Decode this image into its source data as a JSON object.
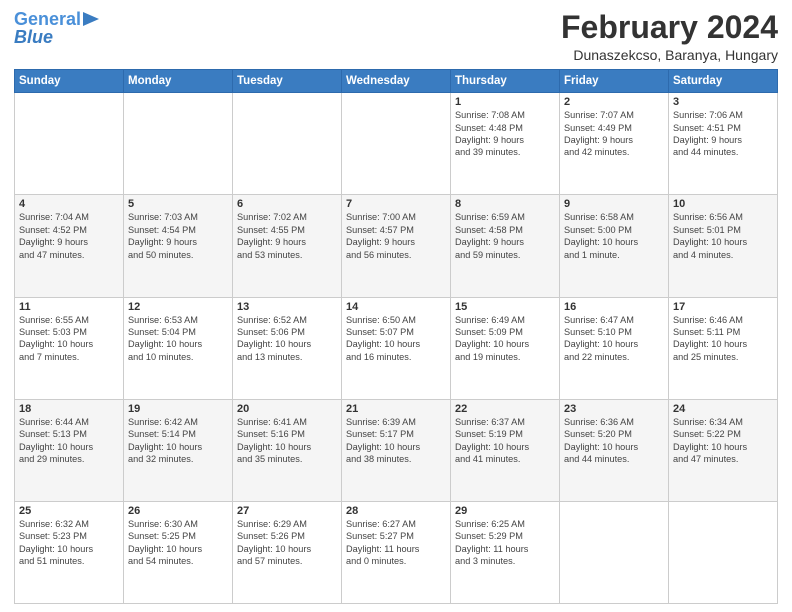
{
  "header": {
    "logo_line1": "General",
    "logo_line2": "Blue",
    "month": "February 2024",
    "location": "Dunaszekcso, Baranya, Hungary"
  },
  "days_of_week": [
    "Sunday",
    "Monday",
    "Tuesday",
    "Wednesday",
    "Thursday",
    "Friday",
    "Saturday"
  ],
  "weeks": [
    [
      {
        "day": "",
        "info": ""
      },
      {
        "day": "",
        "info": ""
      },
      {
        "day": "",
        "info": ""
      },
      {
        "day": "",
        "info": ""
      },
      {
        "day": "1",
        "info": "Sunrise: 7:08 AM\nSunset: 4:48 PM\nDaylight: 9 hours\nand 39 minutes."
      },
      {
        "day": "2",
        "info": "Sunrise: 7:07 AM\nSunset: 4:49 PM\nDaylight: 9 hours\nand 42 minutes."
      },
      {
        "day": "3",
        "info": "Sunrise: 7:06 AM\nSunset: 4:51 PM\nDaylight: 9 hours\nand 44 minutes."
      }
    ],
    [
      {
        "day": "4",
        "info": "Sunrise: 7:04 AM\nSunset: 4:52 PM\nDaylight: 9 hours\nand 47 minutes."
      },
      {
        "day": "5",
        "info": "Sunrise: 7:03 AM\nSunset: 4:54 PM\nDaylight: 9 hours\nand 50 minutes."
      },
      {
        "day": "6",
        "info": "Sunrise: 7:02 AM\nSunset: 4:55 PM\nDaylight: 9 hours\nand 53 minutes."
      },
      {
        "day": "7",
        "info": "Sunrise: 7:00 AM\nSunset: 4:57 PM\nDaylight: 9 hours\nand 56 minutes."
      },
      {
        "day": "8",
        "info": "Sunrise: 6:59 AM\nSunset: 4:58 PM\nDaylight: 9 hours\nand 59 minutes."
      },
      {
        "day": "9",
        "info": "Sunrise: 6:58 AM\nSunset: 5:00 PM\nDaylight: 10 hours\nand 1 minute."
      },
      {
        "day": "10",
        "info": "Sunrise: 6:56 AM\nSunset: 5:01 PM\nDaylight: 10 hours\nand 4 minutes."
      }
    ],
    [
      {
        "day": "11",
        "info": "Sunrise: 6:55 AM\nSunset: 5:03 PM\nDaylight: 10 hours\nand 7 minutes."
      },
      {
        "day": "12",
        "info": "Sunrise: 6:53 AM\nSunset: 5:04 PM\nDaylight: 10 hours\nand 10 minutes."
      },
      {
        "day": "13",
        "info": "Sunrise: 6:52 AM\nSunset: 5:06 PM\nDaylight: 10 hours\nand 13 minutes."
      },
      {
        "day": "14",
        "info": "Sunrise: 6:50 AM\nSunset: 5:07 PM\nDaylight: 10 hours\nand 16 minutes."
      },
      {
        "day": "15",
        "info": "Sunrise: 6:49 AM\nSunset: 5:09 PM\nDaylight: 10 hours\nand 19 minutes."
      },
      {
        "day": "16",
        "info": "Sunrise: 6:47 AM\nSunset: 5:10 PM\nDaylight: 10 hours\nand 22 minutes."
      },
      {
        "day": "17",
        "info": "Sunrise: 6:46 AM\nSunset: 5:11 PM\nDaylight: 10 hours\nand 25 minutes."
      }
    ],
    [
      {
        "day": "18",
        "info": "Sunrise: 6:44 AM\nSunset: 5:13 PM\nDaylight: 10 hours\nand 29 minutes."
      },
      {
        "day": "19",
        "info": "Sunrise: 6:42 AM\nSunset: 5:14 PM\nDaylight: 10 hours\nand 32 minutes."
      },
      {
        "day": "20",
        "info": "Sunrise: 6:41 AM\nSunset: 5:16 PM\nDaylight: 10 hours\nand 35 minutes."
      },
      {
        "day": "21",
        "info": "Sunrise: 6:39 AM\nSunset: 5:17 PM\nDaylight: 10 hours\nand 38 minutes."
      },
      {
        "day": "22",
        "info": "Sunrise: 6:37 AM\nSunset: 5:19 PM\nDaylight: 10 hours\nand 41 minutes."
      },
      {
        "day": "23",
        "info": "Sunrise: 6:36 AM\nSunset: 5:20 PM\nDaylight: 10 hours\nand 44 minutes."
      },
      {
        "day": "24",
        "info": "Sunrise: 6:34 AM\nSunset: 5:22 PM\nDaylight: 10 hours\nand 47 minutes."
      }
    ],
    [
      {
        "day": "25",
        "info": "Sunrise: 6:32 AM\nSunset: 5:23 PM\nDaylight: 10 hours\nand 51 minutes."
      },
      {
        "day": "26",
        "info": "Sunrise: 6:30 AM\nSunset: 5:25 PM\nDaylight: 10 hours\nand 54 minutes."
      },
      {
        "day": "27",
        "info": "Sunrise: 6:29 AM\nSunset: 5:26 PM\nDaylight: 10 hours\nand 57 minutes."
      },
      {
        "day": "28",
        "info": "Sunrise: 6:27 AM\nSunset: 5:27 PM\nDaylight: 11 hours\nand 0 minutes."
      },
      {
        "day": "29",
        "info": "Sunrise: 6:25 AM\nSunset: 5:29 PM\nDaylight: 11 hours\nand 3 minutes."
      },
      {
        "day": "",
        "info": ""
      },
      {
        "day": "",
        "info": ""
      }
    ]
  ]
}
